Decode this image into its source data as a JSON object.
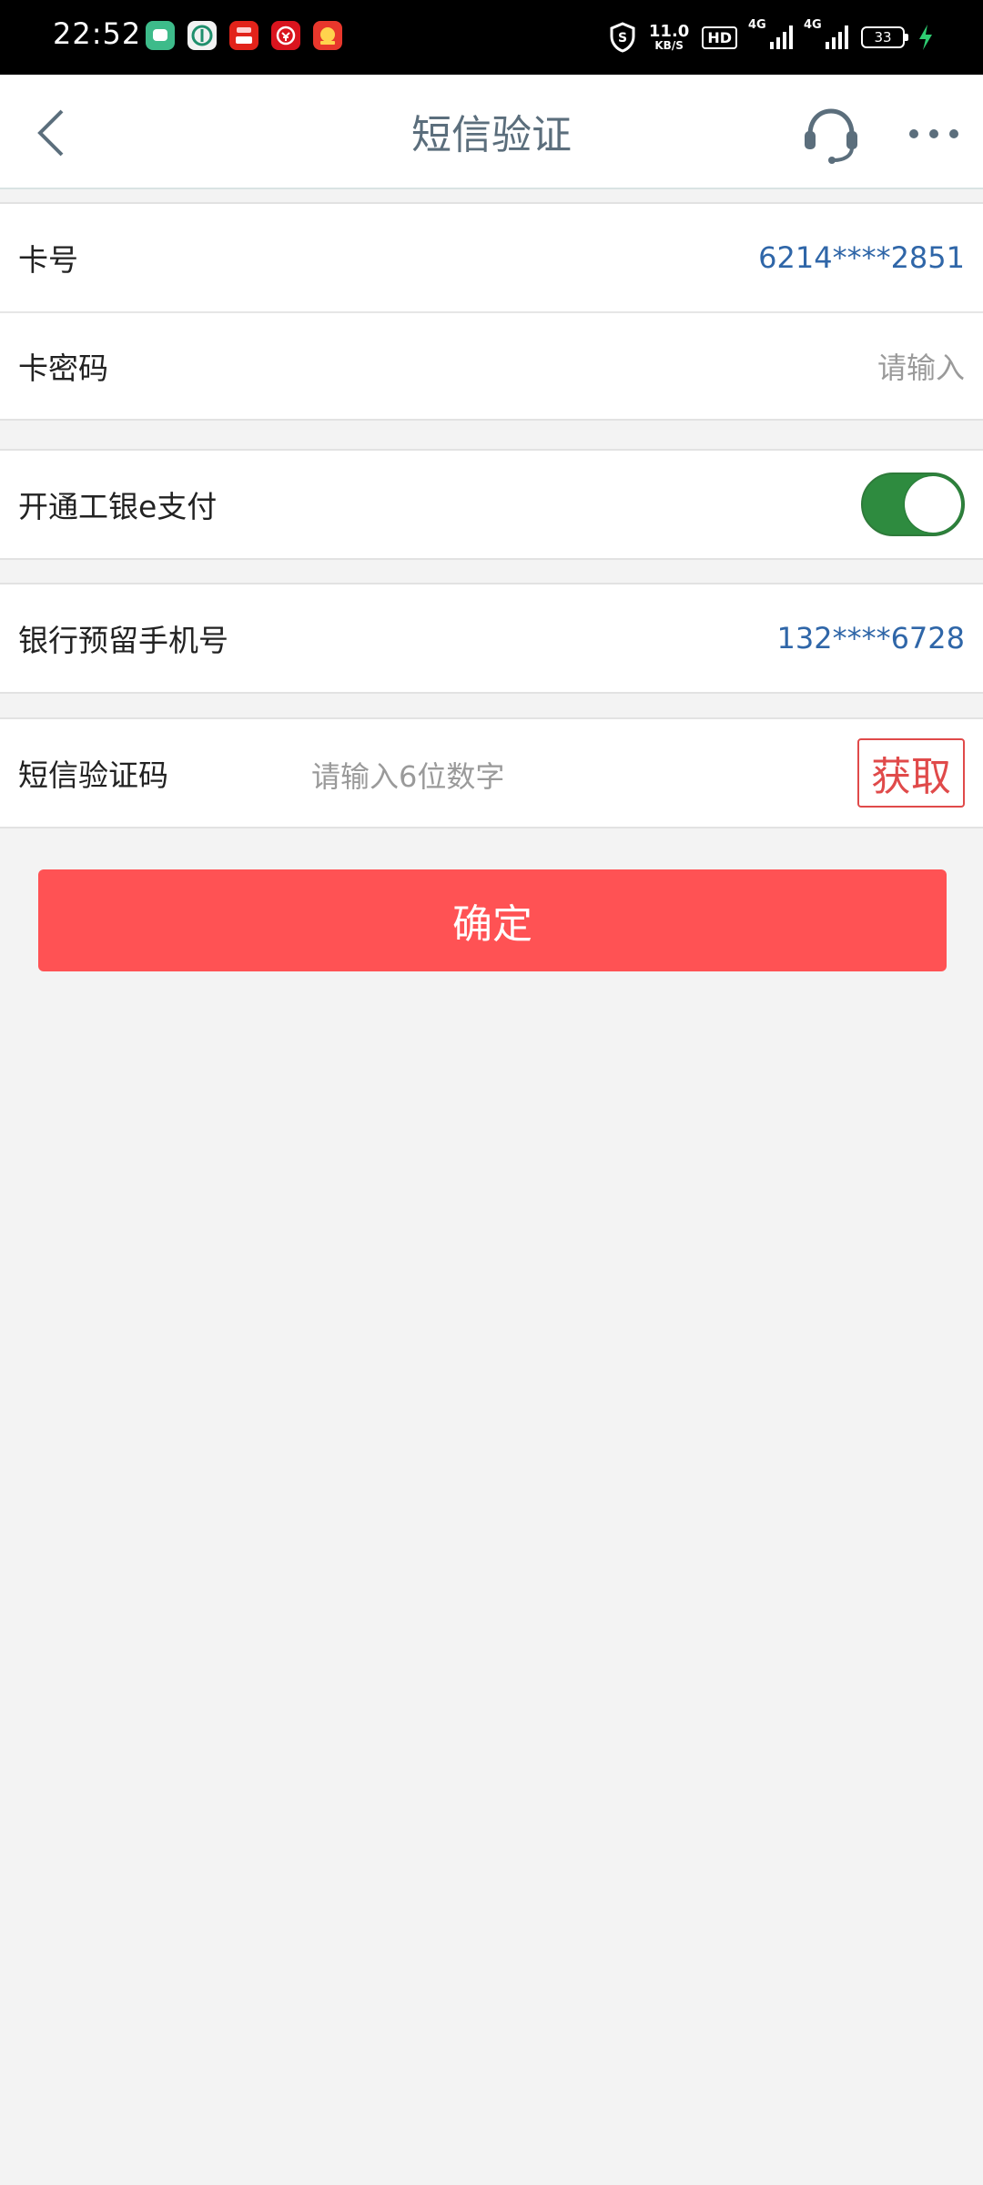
{
  "status_bar": {
    "time": "22:52",
    "speed_value": "11.0",
    "speed_unit": "KB/S",
    "hd": "HD",
    "signal1_label": "4G",
    "signal2_label": "4G",
    "battery": "33",
    "app_icons": [
      "chat-app-icon",
      "agri-bank-icon",
      "red-app-icon",
      "bank-app-icon",
      "ticket-app-icon"
    ]
  },
  "nav": {
    "title": "短信验证",
    "icons": {
      "back": "back-chevron-icon",
      "service": "headset-icon",
      "more": "more-dots-icon"
    }
  },
  "form": {
    "card_number_label": "卡号",
    "card_number_value": "6214****2851",
    "card_password_label": "卡密码",
    "card_password_placeholder": "请输入",
    "epay_label": "开通工银e支付",
    "epay_enabled": true,
    "phone_label": "银行预留手机号",
    "phone_value": "132****6728",
    "sms_label": "短信验证码",
    "sms_placeholder": "请输入6位数字",
    "get_code_label": "获取"
  },
  "confirm_label": "确定",
  "colors": {
    "accent_red": "#ff5254",
    "value_blue": "#2f66a8",
    "toggle_green": "#2e8b3f",
    "title_gray": "#5b6e7c"
  }
}
